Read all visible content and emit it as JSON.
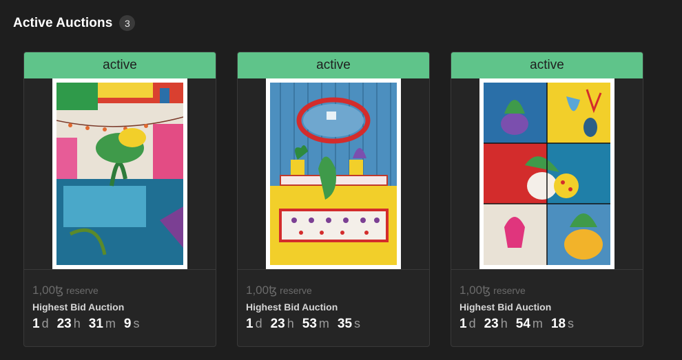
{
  "header": {
    "title": "Active Auctions",
    "count": "3"
  },
  "cards": [
    {
      "status": "active",
      "artwork_icon": "courtyard-garden-artwork",
      "reserve_amount": "1,00ꜩ",
      "reserve_label": "reserve",
      "auction_type": "Highest Bid Auction",
      "countdown": {
        "d": "1",
        "d_suffix": "d",
        "h": "23",
        "h_suffix": "h",
        "m": "31",
        "m_suffix": "m",
        "s": "9",
        "s_suffix": "s"
      }
    },
    {
      "status": "active",
      "artwork_icon": "mirror-plants-room-artwork",
      "reserve_amount": "1,00ꜩ",
      "reserve_label": "reserve",
      "auction_type": "Highest Bid Auction",
      "countdown": {
        "d": "1",
        "d_suffix": "d",
        "h": "23",
        "h_suffix": "h",
        "m": "53",
        "m_suffix": "m",
        "s": "35",
        "s_suffix": "s"
      }
    },
    {
      "status": "active",
      "artwork_icon": "potted-plants-grid-artwork",
      "reserve_amount": "1,00ꜩ",
      "reserve_label": "reserve",
      "auction_type": "Highest Bid Auction",
      "countdown": {
        "d": "1",
        "d_suffix": "d",
        "h": "23",
        "h_suffix": "h",
        "m": "54",
        "m_suffix": "m",
        "s": "18",
        "s_suffix": "s"
      }
    }
  ],
  "colors": {
    "status_green": "#5fc48a",
    "background": "#1e1e1e",
    "card": "#252525"
  }
}
